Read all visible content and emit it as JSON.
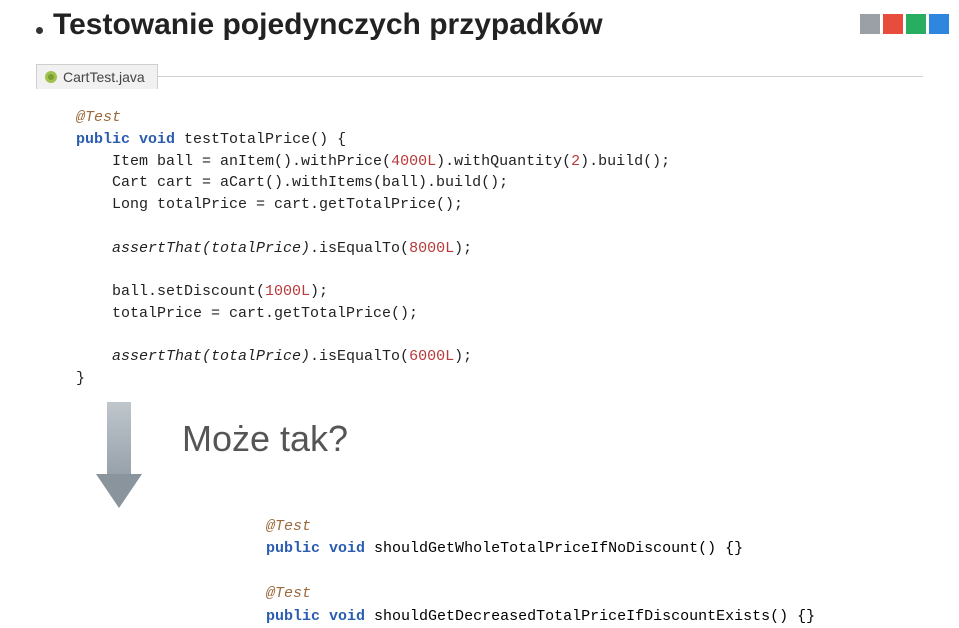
{
  "title": "Testowanie pojedynczych przypadków",
  "tab": {
    "filename": "CartTest.java"
  },
  "code": {
    "annotation": "@Test",
    "kw_public": "public",
    "kw_void": "void",
    "method_sig": " testTotalPrice() {",
    "l1a": "    Item ball = anItem().withPrice(",
    "l1b": "4000L",
    "l1c": ").withQuantity(",
    "l1d": "2",
    "l1e": ").build();",
    "l2": "    Cart cart = aCart().withItems(ball).build();",
    "l3": "    Long totalPrice = cart.getTotalPrice();",
    "l4a": "    assertThat(totalPrice)",
    "l4b": ".isEqualTo(",
    "l4c": "8000L",
    "l4d": ");",
    "l5a": "    ball.setDiscount(",
    "l5b": "1000L",
    "l5c": ");",
    "l6": "    totalPrice = cart.getTotalPrice();",
    "l7a": "    assertThat(totalPrice)",
    "l7b": ".isEqualTo(",
    "l7c": "6000L",
    "l7d": ");",
    "close": "}"
  },
  "question": "Może tak?",
  "bottom": {
    "annotation": "@Test",
    "kw_public": "public",
    "kw_void": "void",
    "m1": " shouldGetWholeTotalPriceIfNoDiscount() {}",
    "m2": " shouldGetDecreasedTotalPriceIfDiscountExists() {}"
  },
  "corner_colors": [
    "#9aa0a6",
    "#e74c3c",
    "#27ae60",
    "#2e86de"
  ]
}
